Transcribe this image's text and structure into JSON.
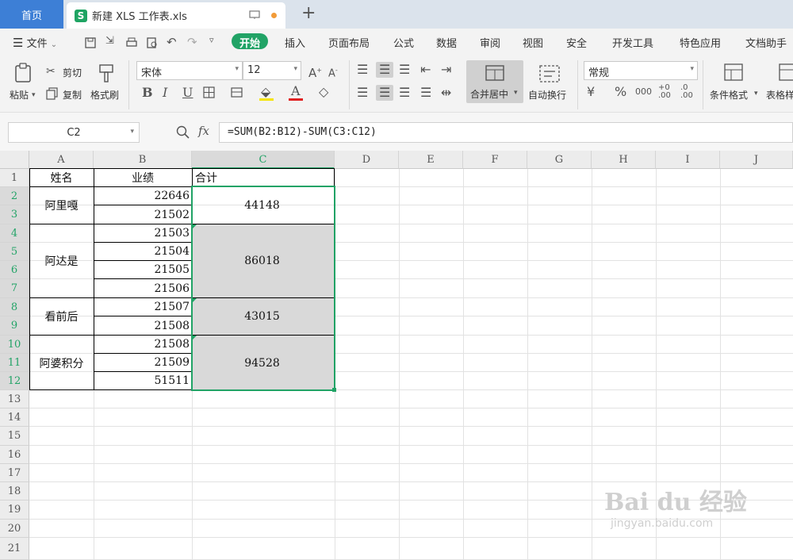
{
  "tabs": {
    "home": "首页",
    "file": "新建 XLS 工作表.xls",
    "add": "+"
  },
  "menu": {
    "file": "文件",
    "items": [
      "开始",
      "插入",
      "页面布局",
      "公式",
      "数据",
      "审阅",
      "视图",
      "安全",
      "开发工具",
      "特色应用",
      "文档助手"
    ]
  },
  "ribbon": {
    "paste": "粘贴",
    "cut": "剪切",
    "copy": "复制",
    "format_painter": "格式刷",
    "font": "宋体",
    "size": "12",
    "merge": "合并居中",
    "wrap": "自动换行",
    "numfmt": "常规",
    "cond": "条件格式",
    "table": "表格样"
  },
  "formula_bar": {
    "cell": "C2",
    "fx": "fx",
    "formula": "=SUM(B2:B12)-SUM(C3:C12)"
  },
  "columns": [
    "A",
    "B",
    "C",
    "D",
    "E",
    "F",
    "G",
    "H",
    "I",
    "J"
  ],
  "rows": [
    "1",
    "2",
    "3",
    "4",
    "5",
    "6",
    "7",
    "8",
    "9",
    "10",
    "11",
    "12",
    "13",
    "14",
    "15",
    "16",
    "17",
    "18",
    "19",
    "20",
    "21"
  ],
  "header_row": {
    "a": "姓名",
    "b": "业绩",
    "c": "合计"
  },
  "names": [
    "阿里嘎",
    "阿达是",
    "看前后",
    "阿婆积分"
  ],
  "b_values": [
    "22646",
    "21502",
    "21503",
    "21504",
    "21505",
    "21506",
    "21507",
    "21508",
    "21508",
    "21509",
    "51511"
  ],
  "totals": [
    "44148",
    "86018",
    "43015",
    "94528"
  ],
  "watermark": {
    "logo": "Bai du 经验",
    "url": "jingyan.baidu.com"
  },
  "colors": {
    "selection": "#21a366",
    "home_tab": "#3d7fd6",
    "selected_fill": "#d9d9d9"
  }
}
